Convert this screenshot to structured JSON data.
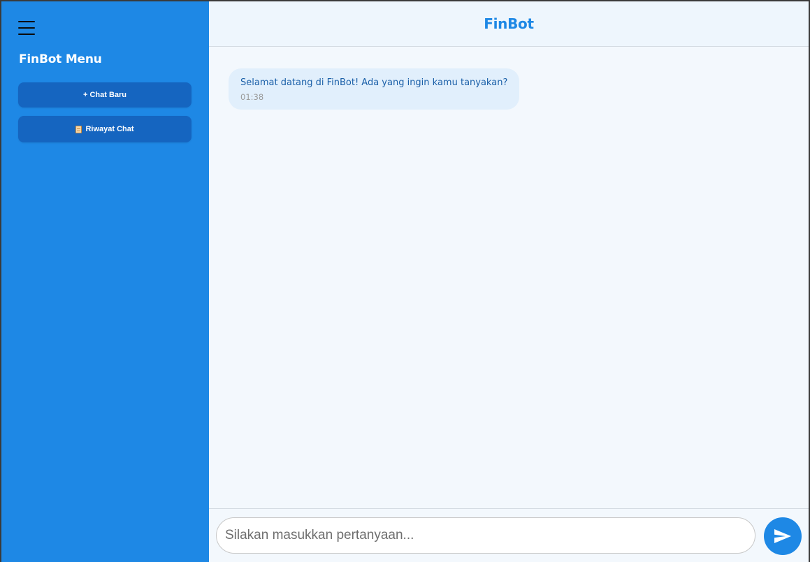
{
  "sidebar": {
    "menu_icon": "hamburger-menu-icon",
    "title": "FinBot Menu",
    "new_chat_label": "+ Chat Baru",
    "history_icon": "scroll-icon",
    "history_label": "Riwayat Chat"
  },
  "header": {
    "title": "FinBot"
  },
  "messages": [
    {
      "sender": "bot",
      "text": "Selamat datang di FinBot! Ada yang ingin kamu tanyakan?",
      "time": "01:38"
    }
  ],
  "composer": {
    "placeholder": "Silakan masukkan pertanyaan...",
    "value": "",
    "send_icon": "send-icon"
  },
  "colors": {
    "sidebar_bg": "#1e88e5",
    "sidebar_button_bg": "#1565c0",
    "accent": "#1e88e5",
    "bot_bubble_bg": "#e1effc",
    "main_bg": "#f3f8fd"
  }
}
